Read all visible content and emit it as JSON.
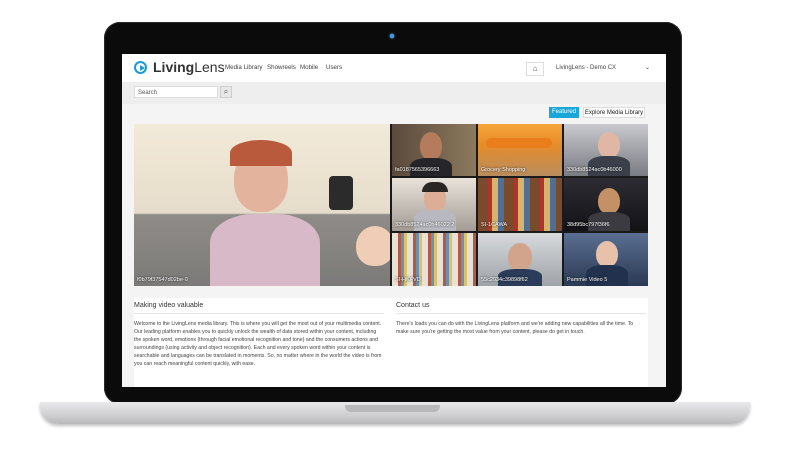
{
  "nav": {
    "logo_bold": "Living",
    "logo_light": "Lens",
    "links": [
      "Media Library",
      "Showreels",
      "Mobile",
      "Users"
    ],
    "org": "LivingLens - Demo CX"
  },
  "search": {
    "placeholder": "Search"
  },
  "buttons": {
    "featured": "Featured",
    "explore": "Explore Media Library"
  },
  "videos": {
    "main": "f0b79f37547d02be-0",
    "t1": "fa0187565396663",
    "t2": "Grocery Shopping",
    "t3": "330db8524ac0b46000",
    "t4": "330db8524ac0b46022 2",
    "t5": "SI-1CAWA",
    "t6": "38d95bc797f36f6",
    "t7": "SI-HKFVD",
    "t8": "55c2034c39898f62",
    "t9": "Pammie Video 5"
  },
  "info": {
    "left_title": "Making video valuable",
    "left_text": "Welcome to the LivingLens media library. This is where you will get the most out of your multimedia content. Our leading platform enables you to quickly unlock the wealth of data stored within your content, including the spoken word, emotions (through facial emotional recognition and tone) and the consumers actions and surroundings (using activity and object recognition). Each and every spoken word within your content is searchable and languages can be translated in moments. So, no matter where in the world the video is from you can reach meaningful content quickly, with ease.",
    "right_title": "Contact us",
    "right_text": "There's loads you can do with the LivingLens platform and we're adding new capabilities all the time. To make sure you're getting the most value from your content, please do get in touch."
  },
  "colors": {
    "accent": "#1aa6d8",
    "frame": "#0b0b0c"
  }
}
